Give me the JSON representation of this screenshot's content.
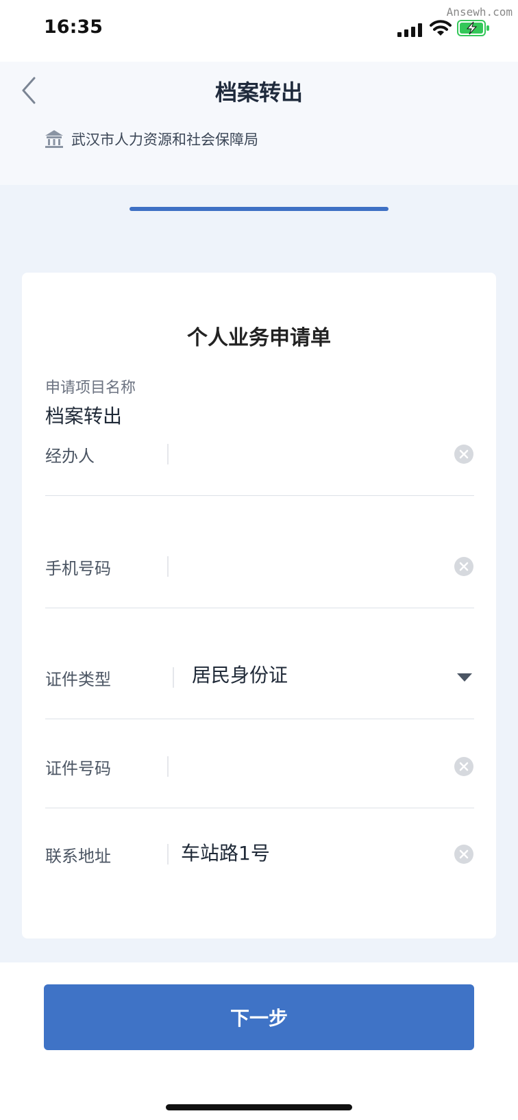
{
  "status_bar": {
    "time": "16:35",
    "watermark": "Ansewh.com",
    "icons": [
      "signal-icon",
      "wifi-icon",
      "battery-charging-icon"
    ],
    "battery_color": "#34c759"
  },
  "header": {
    "title": "档案转出",
    "org_name": "武汉市人力资源和社会保障局",
    "back_icon": "chevron-left-icon",
    "org_icon": "government-building-icon"
  },
  "progress": {
    "color": "#3e70c4"
  },
  "form": {
    "title": "个人业务申请单",
    "project_label": "申请项目名称",
    "project_value": "档案转出",
    "fields": [
      {
        "label": "经办人",
        "value": "",
        "control": "clear-icon"
      },
      {
        "label": "手机号码",
        "value": "",
        "control": "clear-icon"
      },
      {
        "label": "证件类型",
        "value": "居民身份证",
        "control": "dropdown-icon"
      },
      {
        "label": "证件号码",
        "value": "",
        "control": "clear-icon"
      },
      {
        "label": "联系地址",
        "value": "车站路1号",
        "control": "clear-icon"
      }
    ]
  },
  "footer": {
    "next_label": "下一步",
    "button_color": "#3f73c6"
  }
}
